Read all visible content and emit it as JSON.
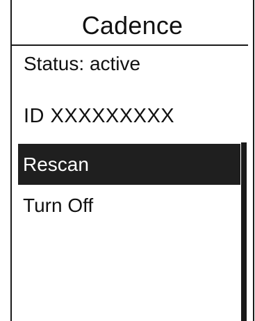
{
  "screen": {
    "title": "Cadence",
    "status_text": "Status: active",
    "device_id_text": "ID XXXXXXXXX"
  },
  "menu": {
    "items": [
      {
        "label": "Rescan",
        "selected": true
      },
      {
        "label": "Turn Off",
        "selected": false
      }
    ]
  },
  "colors": {
    "background": "#ffffff",
    "text": "#111111",
    "selection": "#1f1f1f",
    "selection_text": "#ffffff"
  }
}
